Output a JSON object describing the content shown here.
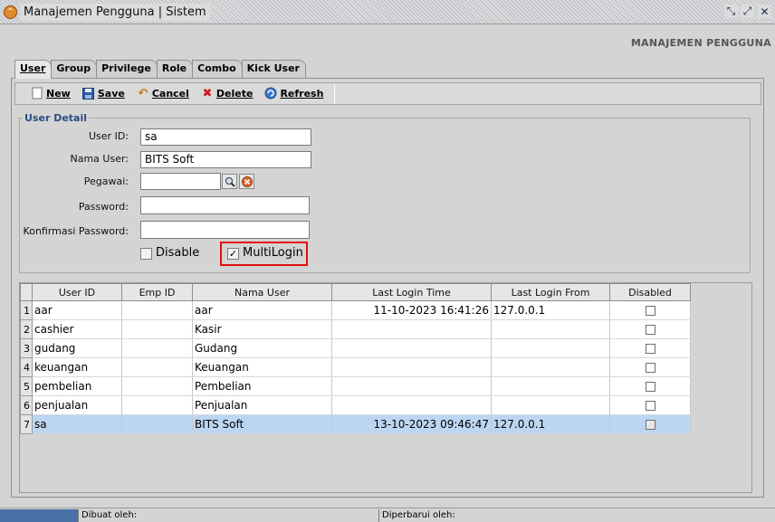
{
  "window": {
    "title": "Manajemen Pengguna | Sistem"
  },
  "page_heading": "MANAJEMEN PENGGUNA",
  "tabs": [
    {
      "label": "User"
    },
    {
      "label": "Group"
    },
    {
      "label": "Privilege"
    },
    {
      "label": "Role"
    },
    {
      "label": "Combo"
    },
    {
      "label": "Kick User"
    }
  ],
  "toolbar": {
    "new": "New",
    "save": "Save",
    "cancel": "Cancel",
    "delete": "Delete",
    "refresh": "Refresh"
  },
  "user_detail": {
    "legend": "User Detail",
    "user_id_label": "User ID:",
    "user_id_value": "sa",
    "nama_user_label": "Nama User:",
    "nama_user_value": "BITS Soft",
    "pegawai_label": "Pegawai:",
    "pegawai_value": "",
    "password_label": "Password:",
    "password_value": "",
    "konfirmasi_label": "Konfirmasi Password:",
    "konfirmasi_value": "",
    "disable_label": "Disable",
    "disable_checked": false,
    "multilogin_label": "MultiLogin",
    "multilogin_checked": true
  },
  "table": {
    "columns": [
      "User ID",
      "Emp ID",
      "Nama User",
      "Last Login Time",
      "Last Login From",
      "Disabled"
    ],
    "rows": [
      {
        "n": "1",
        "user_id": "aar",
        "emp_id": "",
        "nama": "aar",
        "time": "11-10-2023 16:41:26",
        "from": "127.0.0.1",
        "disabled": false
      },
      {
        "n": "2",
        "user_id": "cashier",
        "emp_id": "",
        "nama": "Kasir",
        "time": "",
        "from": "",
        "disabled": false
      },
      {
        "n": "3",
        "user_id": "gudang",
        "emp_id": "",
        "nama": "Gudang",
        "time": "",
        "from": "",
        "disabled": false
      },
      {
        "n": "4",
        "user_id": "keuangan",
        "emp_id": "",
        "nama": "Keuangan",
        "time": "",
        "from": "",
        "disabled": false
      },
      {
        "n": "5",
        "user_id": "pembelian",
        "emp_id": "",
        "nama": "Pembelian",
        "time": "",
        "from": "",
        "disabled": false
      },
      {
        "n": "6",
        "user_id": "penjualan",
        "emp_id": "",
        "nama": "Penjualan",
        "time": "",
        "from": "",
        "disabled": false
      },
      {
        "n": "7",
        "user_id": "sa",
        "emp_id": "",
        "nama": "BITS Soft",
        "time": "13-10-2023 09:46:47",
        "from": "127.0.0.1",
        "disabled": false
      }
    ]
  },
  "statusbar": {
    "created_by": "Dibuat oleh:",
    "updated_by": "Diperbarui oleh:"
  }
}
